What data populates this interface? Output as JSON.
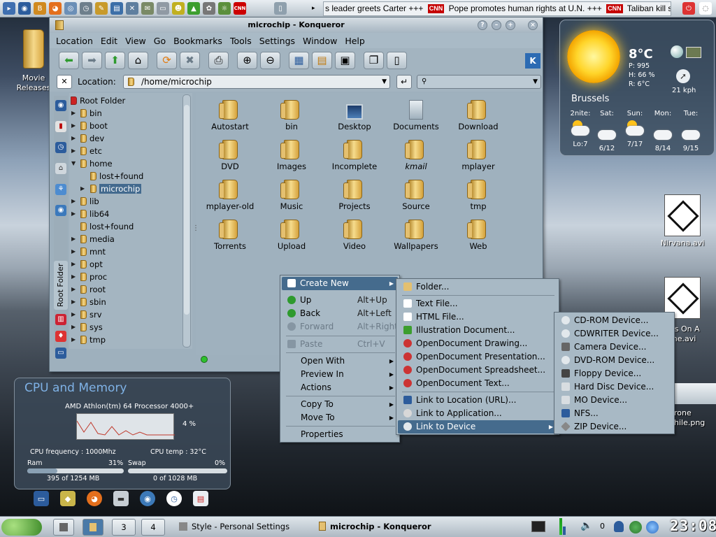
{
  "top_panel": {
    "ticker": "s leader greets Carter +++ CNN Pope promotes human rights at U.N. +++ CNN Taliban kill sol",
    "ticker_parts": [
      "s leader greets Carter +++",
      "Pope promotes human rights at U.N. +++",
      "Taliban kill sol"
    ],
    "cnn_label": "CNN"
  },
  "desktop": {
    "movie_releases": "Movie Releases",
    "nirvana": "Nirvana.avi",
    "video2": "es On A\nme.avi",
    "video2_line1": "es On A",
    "video2_line2": "me.avi",
    "rone": "rone",
    "png": "hile.png"
  },
  "weather": {
    "temp": "8°C",
    "pressure": "P: 995",
    "humidity": "H: 66 %",
    "rain": "R: 6°C",
    "wind": "21 kph",
    "city": "Brussels",
    "forecast": [
      {
        "day": "2nite:",
        "val": "Lo:7"
      },
      {
        "day": "Sat:",
        "val": "6/12"
      },
      {
        "day": "Sun:",
        "val": "7/17"
      },
      {
        "day": "Mon:",
        "val": "8/14"
      },
      {
        "day": "Tue:",
        "val": "9/15"
      }
    ]
  },
  "konqueror": {
    "title": "microchip - Konqueror",
    "menus": [
      "Location",
      "Edit",
      "View",
      "Go",
      "Bookmarks",
      "Tools",
      "Settings",
      "Window",
      "Help"
    ],
    "location_label": "Location:",
    "location_value": "/home/microchip",
    "sidebar_label": "Root Folder",
    "tree": [
      {
        "label": "Root Folder"
      },
      {
        "label": "bin"
      },
      {
        "label": "boot"
      },
      {
        "label": "dev"
      },
      {
        "label": "etc"
      },
      {
        "label": "home"
      },
      {
        "label": "lost+found"
      },
      {
        "label": "microchip"
      },
      {
        "label": "lib"
      },
      {
        "label": "lib64"
      },
      {
        "label": "lost+found"
      },
      {
        "label": "media"
      },
      {
        "label": "mnt"
      },
      {
        "label": "opt"
      },
      {
        "label": "proc"
      },
      {
        "label": "root"
      },
      {
        "label": "sbin"
      },
      {
        "label": "srv"
      },
      {
        "label": "sys"
      },
      {
        "label": "tmp"
      }
    ],
    "files": [
      "Autostart",
      "bin",
      "Desktop",
      "Documents",
      "Download",
      "DVD",
      "Images",
      "Incomplete",
      "kmail",
      "mplayer",
      "mplayer-old",
      "Music",
      "Projects",
      "Source",
      "tmp",
      "Torrents",
      "Upload",
      "Video",
      "Wallpapers",
      "Web"
    ]
  },
  "context_menu": {
    "items": [
      {
        "label": "Create New",
        "accel": ""
      },
      {
        "label": "Up",
        "accel": "Alt+Up"
      },
      {
        "label": "Back",
        "accel": "Alt+Left"
      },
      {
        "label": "Forward",
        "accel": "Alt+Right"
      },
      {
        "label": "Paste",
        "accel": "Ctrl+V"
      },
      {
        "label": "Open With",
        "accel": ""
      },
      {
        "label": "Preview In",
        "accel": ""
      },
      {
        "label": "Actions",
        "accel": ""
      },
      {
        "label": "Copy To",
        "accel": ""
      },
      {
        "label": "Move To",
        "accel": ""
      },
      {
        "label": "Properties",
        "accel": ""
      }
    ]
  },
  "create_new_menu": {
    "items": [
      "Folder...",
      "Text File...",
      "HTML File...",
      "Illustration Document...",
      "OpenDocument Drawing...",
      "OpenDocument Presentation...",
      "OpenDocument Spreadsheet...",
      "OpenDocument Text...",
      "Link to Location (URL)...",
      "Link to Application...",
      "Link to Device"
    ]
  },
  "device_menu": {
    "items": [
      "CD-ROM Device...",
      "CDWRITER Device...",
      "Camera Device...",
      "DVD-ROM Device...",
      "Floppy Device...",
      "Hard Disc Device...",
      "MO Device...",
      "NFS...",
      "ZIP Device..."
    ]
  },
  "cpu_widget": {
    "title": "CPU and Memory",
    "processor": "AMD Athlon(tm) 64 Processor 4000+",
    "usage": "4 %",
    "freq": "CPU frequency : 1000Mhz",
    "temp": "CPU temp : 32°C",
    "ram_label": "Ram",
    "ram_pct": "31%",
    "ram_pct_value": 31,
    "swap_label": "Swap",
    "swap_pct": "0%",
    "swap_pct_value": 0,
    "ram_used": "395 of 1254 MB",
    "swap_used": "0 of 1028 MB"
  },
  "taskbar": {
    "desk3": "3",
    "desk4": "4",
    "task1": "Style - Personal Settings",
    "task2": "microchip - Konqueror",
    "volume": "0",
    "clock": "23:08"
  }
}
